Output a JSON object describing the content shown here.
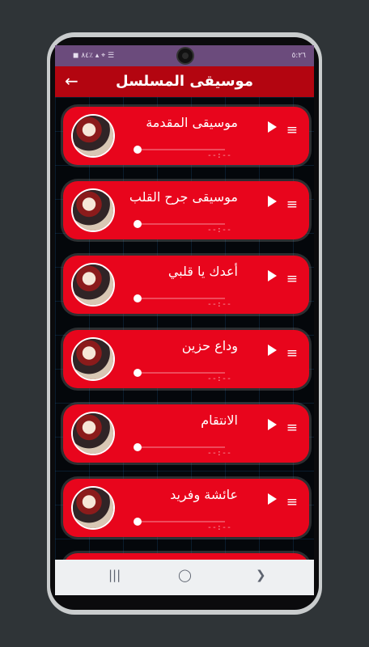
{
  "status": {
    "time": "٥:٢٦",
    "left": "◼ ٨٤٪ ▴ ⌖ ☰"
  },
  "appbar": {
    "title": "موسيقى المسلسل",
    "back": "←"
  },
  "songs": [
    {
      "title": "موسيقى المقدمة",
      "time": "--:--",
      "progress": 0
    },
    {
      "title": "موسيقى جرح القلب",
      "time": "--:--",
      "progress": 0
    },
    {
      "title": "أعدك يا قلبي",
      "time": "--:--",
      "progress": 0
    },
    {
      "title": "وداع حزين",
      "time": "--:--",
      "progress": 0
    },
    {
      "title": "الانتقام",
      "time": "--:--",
      "progress": 0
    },
    {
      "title": "عائشة وفريد",
      "time": "--:--",
      "progress": 0
    },
    {
      "title": "",
      "time": "",
      "progress": 0
    }
  ],
  "icons": {
    "menu": "≡",
    "play": "play-icon",
    "recent": "|||",
    "home": "◯",
    "back": "❯"
  },
  "colors": {
    "accent": "#e8051c",
    "appbar": "#b30510",
    "status": "#6b4b7c"
  }
}
